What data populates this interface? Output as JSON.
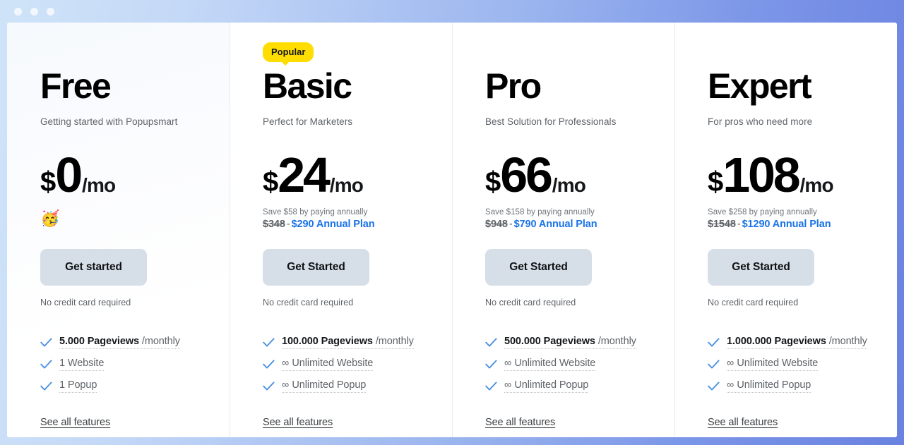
{
  "window": {
    "traffic_lights": [
      "close-dot",
      "minimize-dot",
      "maximize-dot"
    ]
  },
  "plans": [
    {
      "badge": null,
      "name": "Free",
      "tagline": "Getting started with Popupsmart",
      "currency": "$",
      "amount": "0",
      "period": "/mo",
      "emoji": "🥳",
      "savings_note": null,
      "old_price": null,
      "dash": null,
      "new_price": null,
      "cta_label": "Get started",
      "no_card_note": "No credit card required",
      "features": [
        {
          "prefix": "",
          "strong": "5.000 Pageviews",
          "suffix": " /monthly"
        },
        {
          "prefix": "",
          "strong": "",
          "suffix": "1 Website"
        },
        {
          "prefix": "",
          "strong": "",
          "suffix": "1 Popup"
        }
      ],
      "see_all_label": "See all features"
    },
    {
      "badge": "Popular",
      "name": "Basic",
      "tagline": "Perfect for Marketers",
      "currency": "$",
      "amount": "24",
      "period": "/mo",
      "emoji": null,
      "savings_note": "Save $58 by paying annually",
      "old_price": "$348",
      "dash": "-",
      "new_price": "$290 Annual Plan",
      "cta_label": "Get Started",
      "no_card_note": "No credit card required",
      "features": [
        {
          "prefix": "",
          "strong": "100.000 Pageviews",
          "suffix": " /monthly"
        },
        {
          "prefix": "∞ ",
          "strong": "",
          "suffix": "Unlimited Website"
        },
        {
          "prefix": "∞ ",
          "strong": "",
          "suffix": "Unlimited Popup"
        }
      ],
      "see_all_label": "See all features"
    },
    {
      "badge": null,
      "name": "Pro",
      "tagline": "Best Solution for Professionals",
      "currency": "$",
      "amount": "66",
      "period": "/mo",
      "emoji": null,
      "savings_note": "Save $158 by paying annually",
      "old_price": "$948",
      "dash": "-",
      "new_price": "$790 Annual Plan",
      "cta_label": "Get Started",
      "no_card_note": "No credit card required",
      "features": [
        {
          "prefix": "",
          "strong": "500.000 Pageviews",
          "suffix": " /monthly"
        },
        {
          "prefix": "∞ ",
          "strong": "",
          "suffix": "Unlimited Website"
        },
        {
          "prefix": "∞ ",
          "strong": "",
          "suffix": "Unlimited Popup"
        }
      ],
      "see_all_label": "See all features"
    },
    {
      "badge": null,
      "name": "Expert",
      "tagline": "For pros who need more",
      "currency": "$",
      "amount": "108",
      "period": "/mo",
      "emoji": null,
      "savings_note": "Save $258 by paying annually",
      "old_price": "$1548",
      "dash": "-",
      "new_price": "$1290 Annual Plan",
      "cta_label": "Get Started",
      "no_card_note": "No credit card required",
      "features": [
        {
          "prefix": "",
          "strong": "1.000.000 Pageviews",
          "suffix": " /monthly"
        },
        {
          "prefix": "∞ ",
          "strong": "",
          "suffix": "Unlimited Website"
        },
        {
          "prefix": "∞ ",
          "strong": "",
          "suffix": "Unlimited Popup"
        }
      ],
      "see_all_label": "See all features"
    }
  ],
  "colors": {
    "badge_yellow": "#ffdd00",
    "link_blue": "#1a73e8",
    "check_blue": "#4a90e2",
    "button_gray": "#d6dee7",
    "text_muted": "#5f6368"
  }
}
